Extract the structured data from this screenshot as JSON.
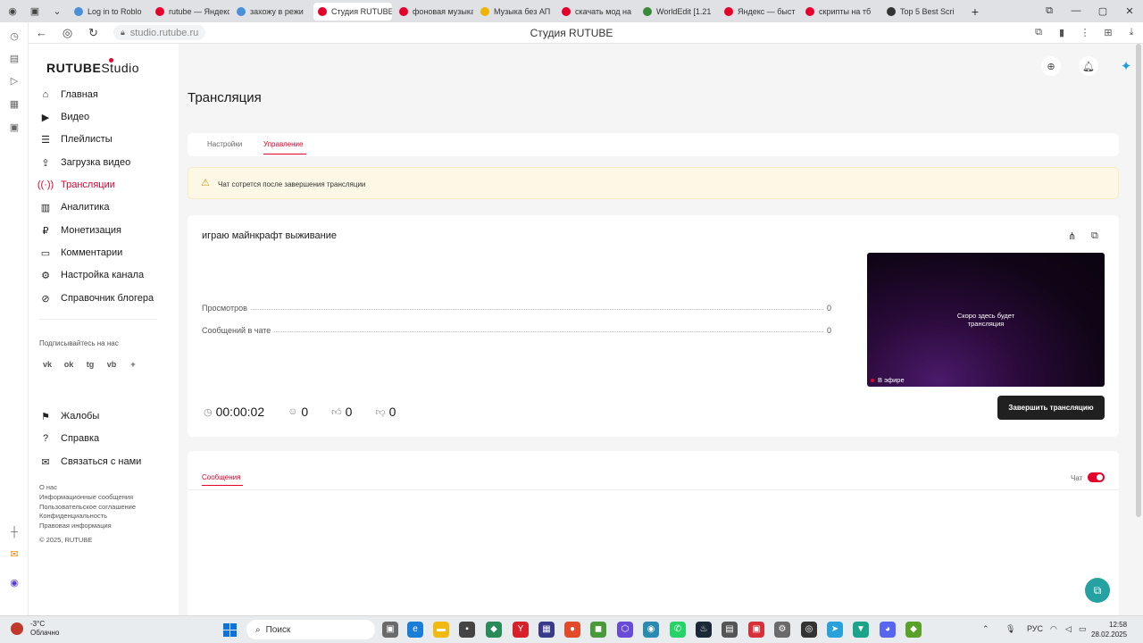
{
  "browser": {
    "tabs": [
      {
        "label": "Log in to Roblo",
        "color": "#4a90d9"
      },
      {
        "label": "rutube — Яндекс",
        "color": "#e4002b"
      },
      {
        "label": "захожу в режи",
        "color": "#4a90d9"
      },
      {
        "label": "Студия RUTUBE",
        "color": "#e4002b",
        "active": true
      },
      {
        "label": "фоновая музыка",
        "color": "#e4002b"
      },
      {
        "label": "Музыка без АП",
        "color": "#f0b400"
      },
      {
        "label": "скачать мод на",
        "color": "#e4002b"
      },
      {
        "label": "WorldEdit [1.21",
        "color": "#3a8a3a"
      },
      {
        "label": "Яндекс — быст",
        "color": "#e4002b"
      },
      {
        "label": "скрипты на тб",
        "color": "#e4002b"
      },
      {
        "label": "Top 5 Best Scri",
        "color": "#333333"
      }
    ],
    "url": "studio.rutube.ru",
    "page_title": "Студия RUTUBE"
  },
  "sidebar": {
    "logo": "RUTUBE",
    "logo_suffix": "Studio",
    "nav": [
      {
        "label": "Главная",
        "icon": "home-icon",
        "glyph": "⌂"
      },
      {
        "label": "Видео",
        "icon": "video-icon",
        "glyph": "▶"
      },
      {
        "label": "Плейлисты",
        "icon": "playlist-icon",
        "glyph": "☰"
      },
      {
        "label": "Загрузка видео",
        "icon": "upload-icon",
        "glyph": "⇪"
      },
      {
        "label": "Трансляции",
        "icon": "broadcast-icon",
        "glyph": "((·))",
        "active": true
      },
      {
        "label": "Аналитика",
        "icon": "analytics-icon",
        "glyph": "▥"
      },
      {
        "label": "Монетизация",
        "icon": "money-icon",
        "glyph": "₽"
      },
      {
        "label": "Комментарии",
        "icon": "comment-icon",
        "glyph": "▭"
      },
      {
        "label": "Настройка канала",
        "icon": "settings-icon",
        "glyph": "⚙"
      },
      {
        "label": "Справочник блогера",
        "icon": "guide-icon",
        "glyph": "⊘"
      }
    ],
    "subscribe_label": "Подписывайтесь на нас",
    "socials": [
      "vk",
      "ok",
      "tg",
      "vb",
      "+"
    ],
    "support": [
      {
        "label": "Жалобы",
        "icon": "flag-icon",
        "glyph": "⚑"
      },
      {
        "label": "Справка",
        "icon": "help-icon",
        "glyph": "?"
      },
      {
        "label": "Связаться с нами",
        "icon": "mail-icon",
        "glyph": "✉"
      }
    ],
    "footer_links": [
      "О нас",
      "Информационные сообщения",
      "Пользовательское соглашение",
      "Конфиденциальность",
      "Правовая информация"
    ],
    "copyright": "© 2025, RUTUBE"
  },
  "page": {
    "title": "Трансляция",
    "tabs": [
      "Настройки",
      "Управление"
    ],
    "active_tab": "Управление",
    "warning": "Чат сотрется после завершения трансляции"
  },
  "stream": {
    "title": "играю майнкрафт выживание",
    "stats": [
      {
        "label": "Просмотров",
        "value": "0"
      },
      {
        "label": "Сообщений в чате",
        "value": "0"
      }
    ],
    "preview_text_line1": "Скоро здесь будет",
    "preview_text_line2": "трансляция",
    "live_label": "В эфире",
    "duration": "00:00:02",
    "viewers": "0",
    "likes": "0",
    "dislikes": "0",
    "end_button": "Завершить трансляцию"
  },
  "chat": {
    "tab_label": "Сообщения",
    "toggle_label": "Чат",
    "toggle_on": true
  },
  "taskbar": {
    "weather_temp": "-3°C",
    "weather_desc": "Облачно",
    "search_placeholder": "Поиск",
    "lang": "РУС",
    "time": "12:58",
    "date": "28.02.2025"
  },
  "colors": {
    "accent": "#e4002b",
    "button_dark": "#202020",
    "warning_bg": "#fdf8e6"
  }
}
